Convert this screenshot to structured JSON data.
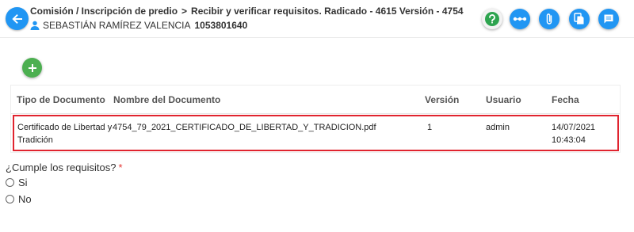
{
  "header": {
    "breadcrumb_part1": "Comisión / Inscripción de predio",
    "breadcrumb_separator": ">",
    "breadcrumb_part2": "Recibir y verificar requisitos. Radicado - 4615 Versión - 4754",
    "user_name": "SEBASTIÁN RAMÍREZ VALENCIA",
    "user_id": "1053801640"
  },
  "toolbar": {
    "icons": [
      "back-arrow-icon",
      "help-icon",
      "more-dots-icon",
      "attach-icon",
      "copy-document-icon",
      "comments-icon"
    ],
    "colors": {
      "primary": "#2196f3",
      "help": "#2ea44f",
      "add": "#4caf50"
    }
  },
  "table": {
    "columns": [
      "Tipo de Documento",
      "Nombre del Documento",
      "Versión",
      "Usuario",
      "Fecha"
    ],
    "rows": [
      {
        "tipo_line1": "Certificado de Libertad y",
        "tipo_line2": "Tradición",
        "nombre": "4754_79_2021_CERTIFICADO_DE_LIBERTAD_Y_TRADICION.pdf",
        "version": "1",
        "usuario": "admin",
        "fecha_line1": "14/07/2021",
        "fecha_line2": "10:43:04"
      }
    ],
    "highlight_color": "#e0242f"
  },
  "form": {
    "question": "¿Cumple los requisitos?",
    "required_mark": "*",
    "options": [
      "Si",
      "No"
    ]
  }
}
